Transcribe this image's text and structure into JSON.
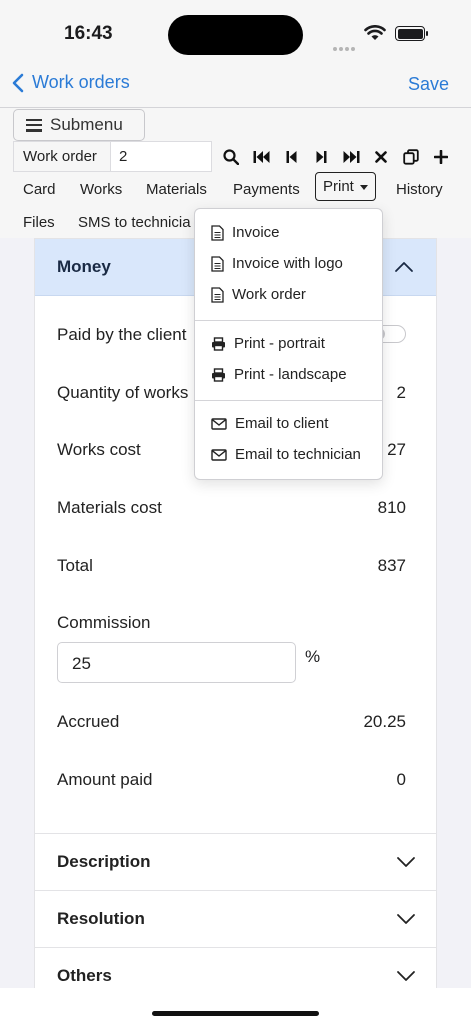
{
  "status_bar": {
    "time": "16:43"
  },
  "nav": {
    "back_label": "Work orders",
    "save_label": "Save"
  },
  "toolbar": {
    "submenu_label": "Submenu",
    "order_label": "Work order",
    "order_value": "2",
    "icons": [
      "search-icon",
      "first-record-icon",
      "previous-record-icon",
      "next-record-icon",
      "last-record-icon",
      "delete-icon",
      "copy-icon",
      "add-icon"
    ]
  },
  "tabs": [
    {
      "label": "Card"
    },
    {
      "label": "Works"
    },
    {
      "label": "Materials"
    },
    {
      "label": "Payments"
    },
    {
      "label": "Print"
    },
    {
      "label": "History"
    },
    {
      "label": "Files"
    },
    {
      "label": "SMS to technicia"
    }
  ],
  "print_menu": {
    "group1": [
      "Invoice",
      "Invoice with logo",
      "Work order"
    ],
    "group2": [
      "Print - portrait",
      "Print - landscape"
    ],
    "group3": [
      "Email to client",
      "Email to technician"
    ]
  },
  "money": {
    "title": "Money",
    "paid_by_client_label": "Paid by the client",
    "paid_by_client": false,
    "fields": [
      {
        "label": "Quantity of works",
        "value": "2"
      },
      {
        "label": "Works cost",
        "value": "27"
      },
      {
        "label": "Materials cost",
        "value": "810"
      },
      {
        "label": "Total",
        "value": "837"
      }
    ],
    "commission_label": "Commission",
    "commission_value": "25",
    "commission_unit": "%",
    "accrued_label": "Accrued",
    "accrued_value": "20.25",
    "amount_paid_label": "Amount paid",
    "amount_paid_value": "0"
  },
  "sections": [
    {
      "title": "Description"
    },
    {
      "title": "Resolution"
    },
    {
      "title": "Others"
    }
  ],
  "colors": {
    "accent": "#2b7bd6",
    "section_header_bg": "#d9e7fb"
  }
}
